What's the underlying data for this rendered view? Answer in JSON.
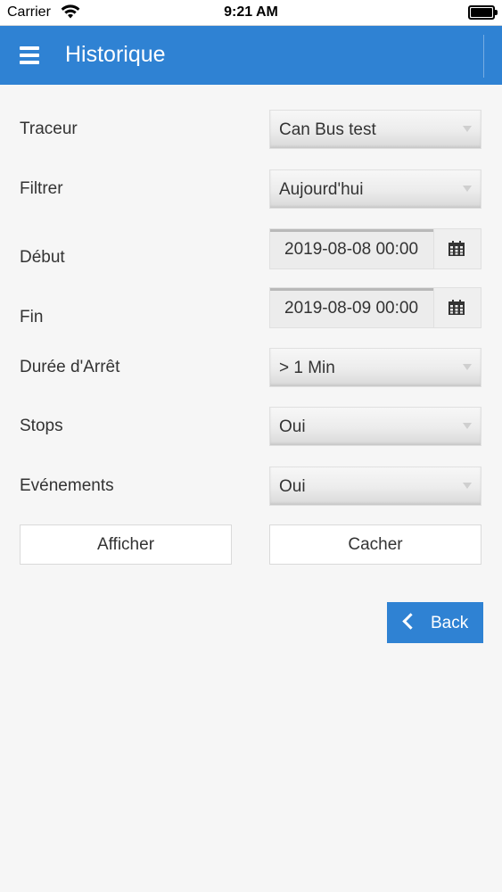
{
  "status_bar": {
    "carrier": "Carrier",
    "time": "9:21 AM"
  },
  "header": {
    "title": "Historique"
  },
  "form": {
    "tracker": {
      "label": "Traceur",
      "value": "Can Bus test"
    },
    "filter": {
      "label": "Filtrer",
      "value": "Aujourd'hui"
    },
    "start": {
      "label": "Début",
      "value": "2019-08-08 00:00"
    },
    "end": {
      "label": "Fin",
      "value": "2019-08-09 00:00"
    },
    "stop_duration": {
      "label": "Durée d'Arrêt",
      "value": "> 1 Min"
    },
    "stops": {
      "label": "Stops",
      "value": "Oui"
    },
    "events": {
      "label": "Evénements",
      "value": "Oui"
    }
  },
  "buttons": {
    "show": "Afficher",
    "hide": "Cacher",
    "back": "Back"
  },
  "colors": {
    "accent": "#2f82d3",
    "background": "#f6f6f6"
  }
}
